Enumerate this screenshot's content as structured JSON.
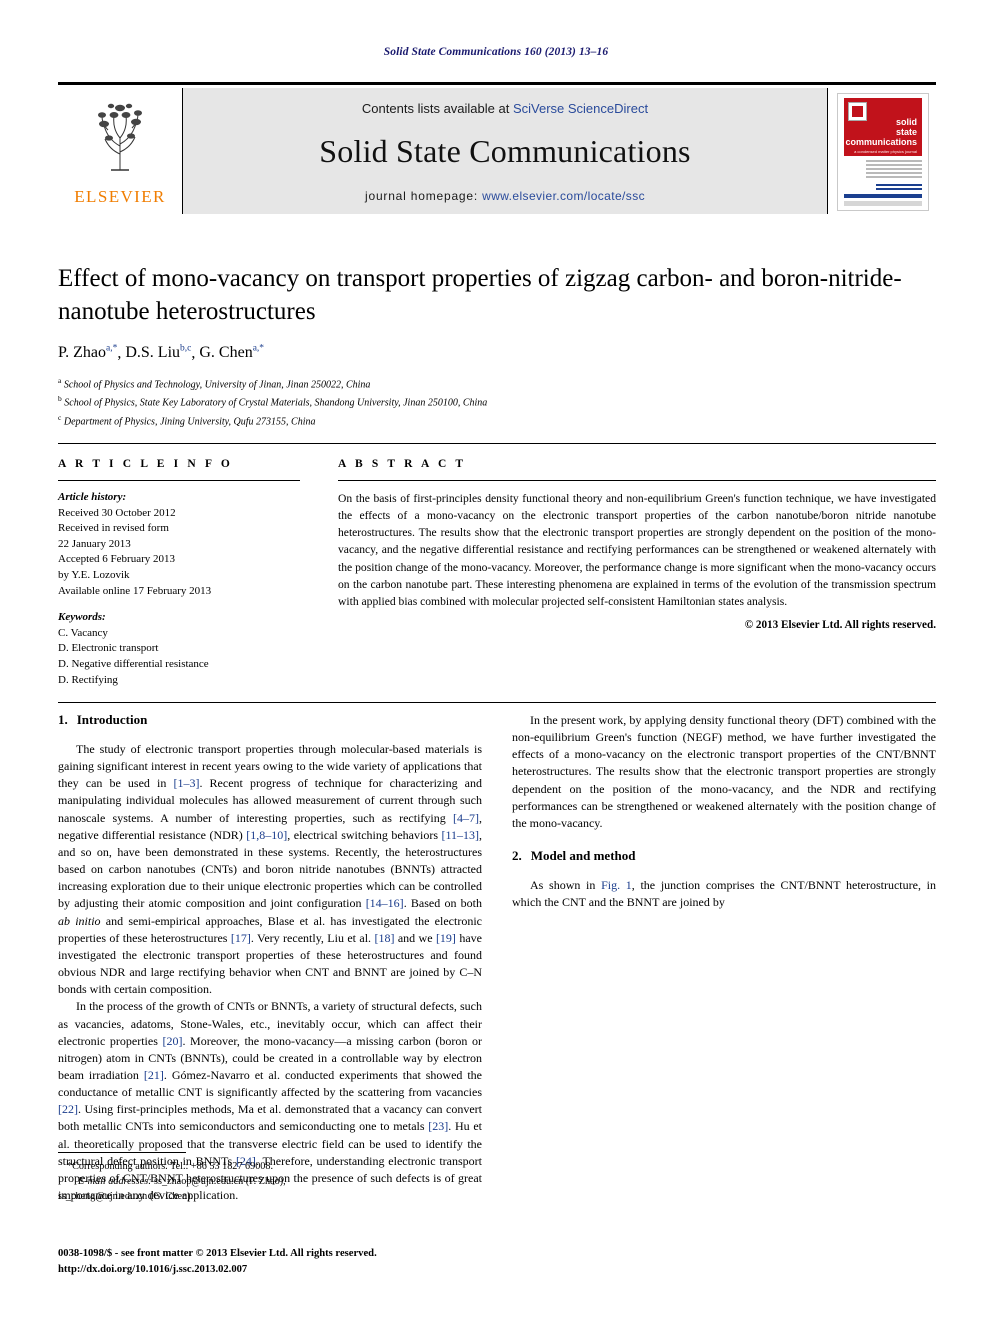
{
  "running_head": "Solid State Communications 160 (2013) 13–16",
  "masthead": {
    "publisher_name": "ELSEVIER",
    "contents_prefix": "Contents lists available at ",
    "contents_link": "SciVerse ScienceDirect",
    "journal_title": "Solid State Communications",
    "homepage_prefix": "journal homepage: ",
    "homepage_link": "www.elsevier.com/locate/ssc",
    "cover": {
      "line1": "solid",
      "line2": "state",
      "line3": "communications",
      "subtitle": "a condensed matter physics journal"
    }
  },
  "article": {
    "title": "Effect of mono-vacancy on transport properties of zigzag carbon- and boron-nitride-nanotube heterostructures",
    "authors": [
      {
        "name": "P. Zhao",
        "sup": "a,*"
      },
      {
        "name": "D.S. Liu",
        "sup": "b,c"
      },
      {
        "name": "G. Chen",
        "sup": "a,*"
      }
    ],
    "affiliations": [
      {
        "label": "a",
        "text": "School of Physics and Technology, University of Jinan, Jinan 250022, China"
      },
      {
        "label": "b",
        "text": "School of Physics, State Key Laboratory of Crystal Materials, Shandong University, Jinan 250100, China"
      },
      {
        "label": "c",
        "text": "Department of Physics, Jining University, Qufu 273155, China"
      }
    ]
  },
  "article_info": {
    "heading": "A R T I C L E   I N F O",
    "history_label": "Article history:",
    "history": [
      "Received 30 October 2012",
      "Received in revised form",
      "22 January 2013",
      "Accepted 6 February 2013",
      "by Y.E. Lozovik",
      "Available online 17 February 2013"
    ],
    "keywords_label": "Keywords:",
    "keywords": [
      "C. Vacancy",
      "D. Electronic transport",
      "D. Negative differential resistance",
      "D. Rectifying"
    ]
  },
  "abstract": {
    "heading": "A B S T R A C T",
    "text": "On the basis of first-principles density functional theory and non-equilibrium Green's function technique, we have investigated the effects of a mono-vacancy on the electronic transport properties of the carbon nanotube/boron nitride nanotube heterostructures. The results show that the electronic transport properties are strongly dependent on the position of the mono-vacancy, and the negative differential resistance and rectifying performances can be strengthened or weakened alternately with the position change of the mono-vacancy. Moreover, the performance change is more significant when the mono-vacancy occurs on the carbon nanotube part. These interesting phenomena are explained in terms of the evolution of the transmission spectrum with applied bias combined with molecular projected self-consistent Hamiltonian states analysis.",
    "copyright": "© 2013 Elsevier Ltd. All rights reserved."
  },
  "sections": {
    "intro": {
      "number": "1.",
      "title": "Introduction",
      "p1_a": "The study of electronic transport properties through molecular-based materials is gaining significant interest in recent years owing to the wide variety of applications that they can be used in ",
      "p1_r1": "[1–3]",
      "p1_b": ". Recent progress of technique for characterizing and manipulating individual molecules has allowed measurement of current through such nanoscale systems. A number of interesting properties, such as rectifying ",
      "p1_r2": "[4–7]",
      "p1_c": ", negative differential resistance (NDR) ",
      "p1_r3": "[1,8–10]",
      "p1_d": ", electrical switching behaviors ",
      "p1_r4": "[11–13]",
      "p1_e": ", and so on, have been demonstrated in these systems. Recently, the heterostructures based on carbon nanotubes (CNTs) and boron nitride nanotubes (BNNTs) attracted increasing exploration due to their unique electronic properties which can be controlled by adjusting their atomic composition and joint configuration ",
      "p1_r5": "[14–16]",
      "p1_f": ". Based on both ",
      "p1_ital": "ab initio",
      "p1_g": " and semi-empirical approaches, Blase et al. has investigated the electronic properties of these heterostructures ",
      "p1_r6": "[17]",
      "p1_h": ". Very recently, Liu et al. ",
      "p1_r7": "[18]",
      "p1_i": " and we ",
      "p1_r8": "[19]",
      "p1_j": " have investigated the electronic transport properties of these heterostructures and found obvious NDR and large rectifying behavior when CNT and BNNT are joined by C–N bonds with certain composition.",
      "p2_a": "In the process of the growth of CNTs or BNNTs, a variety of structural defects, such as vacancies, adatoms, Stone-Wales, etc., inevitably occur, which can affect their electronic properties ",
      "p2_r1": "[20]",
      "p2_b": ". Moreover, the mono-vacancy—a missing carbon (boron or nitrogen) atom in CNTs (BNNTs), could be created in a controllable way by electron beam irradiation ",
      "p2_r2": "[21]",
      "p2_c": ". Gómez-Navarro et al. conducted experiments that showed the conductance of metallic CNT is significantly affected by the scattering from vacancies ",
      "p2_r3": "[22]",
      "p2_d": ". Using first-principles methods, Ma et al. demonstrated that a vacancy can convert both metallic CNTs into semiconductors and semiconducting one to metals ",
      "p2_r4": "[23]",
      "p2_e": ". Hu et al. theoretically proposed that the transverse electric field can be used to identify the structural defect position in BNNTs ",
      "p2_r5": "[24]",
      "p2_f": ". Therefore, understanding electronic transport properties of CNT/BNNT heterostructures upon the presence of such defects is of great importance in any device application.",
      "p3": "In the present work, by applying density functional theory (DFT) combined with the non-equilibrium Green's function (NEGF) method, we have further investigated the effects of a mono-vacancy on the electronic transport properties of the CNT/BNNT heterostructures. The results show that the electronic transport properties are strongly dependent on the position of the mono-vacancy, and the NDR and rectifying performances can be strengthened or weakened alternately with the position change of the mono-vacancy."
    },
    "model": {
      "number": "2.",
      "title": "Model and method",
      "p1_a": "As shown in ",
      "p1_ref": "Fig. 1",
      "p1_b": ", the junction comprises the CNT/BNNT heterostructure, in which the CNT and the BNNT are joined by"
    }
  },
  "footnote": {
    "corresponding": "Corresponding authors. Tel.: +86 53 1827 69008.",
    "email_label": "E-mail addresses:",
    "email1": "ss_zhaop@ujn.edu.cn (P. Zhao),",
    "email2": "ss_cheng@ujn.edu.cn (G. Chen)."
  },
  "imprint": {
    "line1": "0038-1098/$ - see front matter © 2013 Elsevier Ltd. All rights reserved.",
    "line2": "http://dx.doi.org/10.1016/j.ssc.2013.02.007"
  }
}
